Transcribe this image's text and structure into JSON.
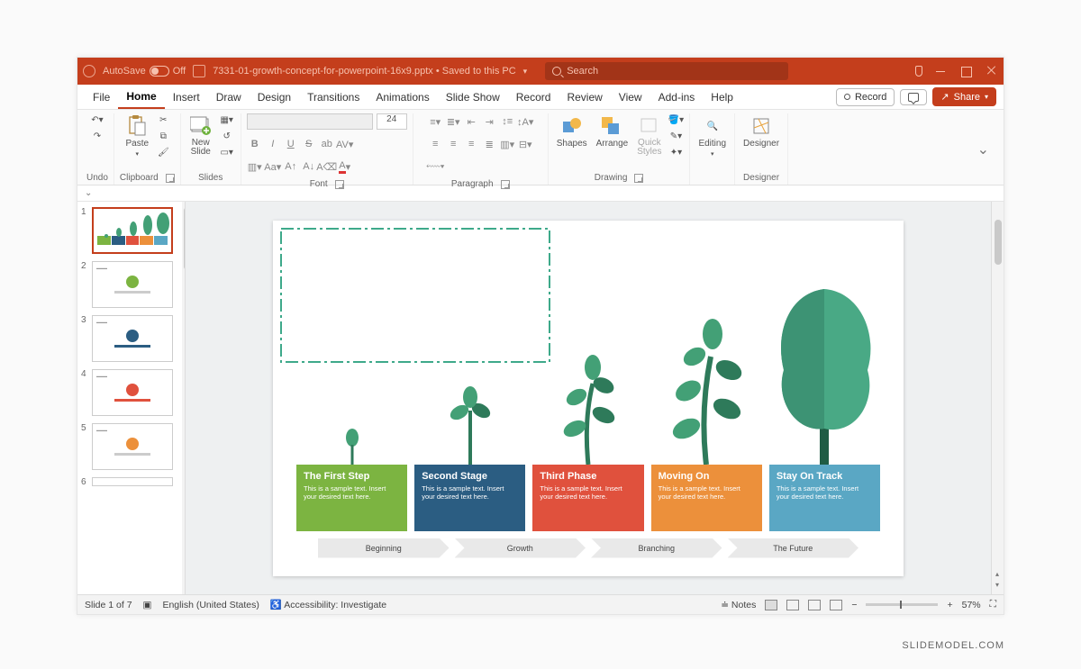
{
  "titlebar": {
    "autosave_label": "AutoSave",
    "autosave_state": "Off",
    "file_title": "7331-01-growth-concept-for-powerpoint-16x9.pptx • Saved to this PC",
    "search_placeholder": "Search"
  },
  "menu": {
    "tabs": [
      "File",
      "Home",
      "Insert",
      "Draw",
      "Design",
      "Transitions",
      "Animations",
      "Slide Show",
      "Record",
      "Review",
      "View",
      "Add-ins",
      "Help"
    ],
    "active": "Home",
    "record_btn": "Record",
    "share_btn": "Share"
  },
  "ribbon": {
    "undo": {
      "label": "Undo"
    },
    "clipboard": {
      "label": "Clipboard",
      "paste": "Paste"
    },
    "slides": {
      "label": "Slides",
      "new_slide": "New\nSlide"
    },
    "font": {
      "label": "Font",
      "size": "24"
    },
    "paragraph": {
      "label": "Paragraph"
    },
    "drawing": {
      "label": "Drawing",
      "shapes": "Shapes",
      "arrange": "Arrange",
      "quick_styles": "Quick\nStyles"
    },
    "editing": {
      "label": "Editing",
      "btn": "Editing"
    },
    "designer": {
      "label": "Designer",
      "btn": "Designer"
    }
  },
  "thumbnails": {
    "count": 7,
    "visible": [
      "1",
      "2",
      "3",
      "4",
      "5",
      "6"
    ]
  },
  "slide": {
    "cards": [
      {
        "title": "The First Step",
        "body": "This is a sample text. Insert your desired text here.",
        "color": "#7cb441",
        "arrow": "Beginning"
      },
      {
        "title": "Second Stage",
        "body": "This is a sample text. Insert your desired text here.",
        "color": "#2b5d82",
        "arrow": "Growth"
      },
      {
        "title": "Third Phase",
        "body": "This is a sample text. Insert your desired text here.",
        "color": "#e0513d",
        "arrow": "Branching"
      },
      {
        "title": "Moving On",
        "body": "This is a sample text. Insert your desired text here.",
        "color": "#ec903b",
        "arrow": "The Future"
      },
      {
        "title": "Stay On Track",
        "body": "This is a sample text. Insert your desired text here.",
        "color": "#5aa7c4",
        "arrow": ""
      }
    ]
  },
  "statusbar": {
    "slide_counter": "Slide 1 of 7",
    "language": "English (United States)",
    "accessibility": "Accessibility: Investigate",
    "notes": "Notes",
    "zoom": "57%"
  },
  "watermark": "SLIDEMODEL.COM"
}
